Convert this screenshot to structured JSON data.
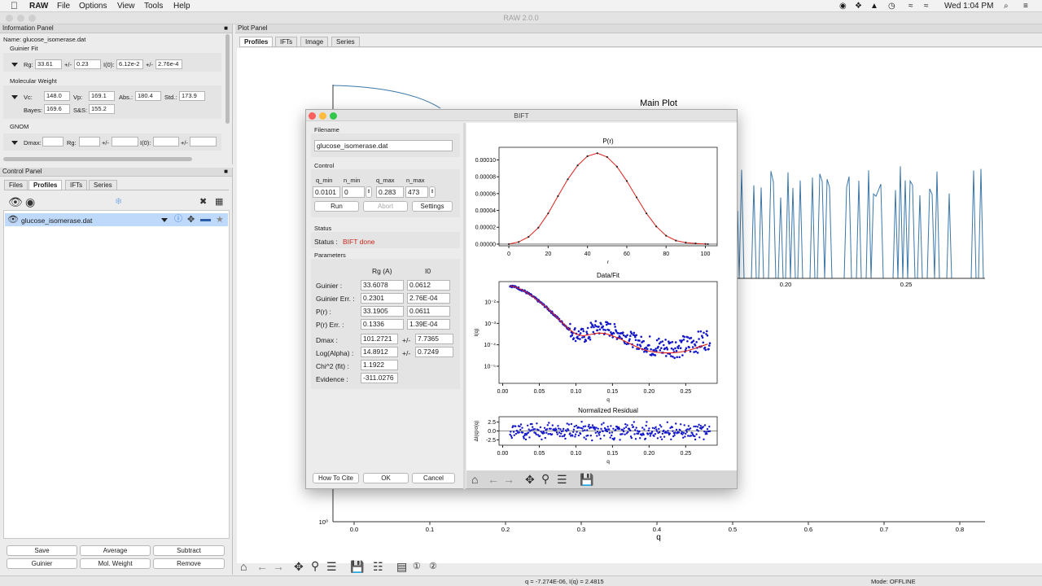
{
  "menubar": {
    "app": "RAW",
    "items": [
      "File",
      "Options",
      "View",
      "Tools",
      "Help"
    ],
    "clock": "Wed 1:04 PM"
  },
  "window": {
    "title": "RAW 2.0.0"
  },
  "info_panel": {
    "title": "Information Panel",
    "name": "Name:  glucose_isomerase.dat",
    "guinier": {
      "title": "Guinier Fit",
      "rg_label": "Rg:",
      "rg": "33.61",
      "pm": "+/-",
      "rg_err": "0.23",
      "i0_label": "I(0):",
      "i0": "6.12e-2",
      "i0_err": "2.76e-4"
    },
    "mw": {
      "title": "Molecular Weight",
      "vc_label": "Vc:",
      "vc": "148.0",
      "vp_label": "Vp:",
      "vp": "169.1",
      "abs_label": "Abs.:",
      "abs": "180.4",
      "std_label": "Std.:",
      "std": "173.9",
      "bayes_label": "Bayes:",
      "bayes": "169.6",
      "ss_label": "S&S:",
      "ss": "155.2"
    },
    "gnom": {
      "title": "GNOM",
      "dmax_label": "Dmax:",
      "rg_label": "Rg:",
      "pm": "+/-",
      "i0_label": "I(0):"
    }
  },
  "control_panel": {
    "title": "Control Panel",
    "tabs": [
      "Files",
      "Profiles",
      "IFTs",
      "Series"
    ],
    "item": "glucose_isomerase.dat",
    "buttons": [
      "Save",
      "Average",
      "Subtract",
      "Guinier",
      "Mol. Weight",
      "Remove"
    ]
  },
  "plot_panel": {
    "title": "Plot Panel",
    "tabs": [
      "Profiles",
      "IFTs",
      "Image",
      "Series"
    ],
    "main_title": "Main Plot",
    "x_label": "q",
    "x_ticks": [
      "0.0",
      "0.1",
      "0.2",
      "0.3",
      "0.4",
      "0.5",
      "0.6",
      "0.7",
      "0.8"
    ],
    "y_tick": "10⁰",
    "top_ticks": [
      "0.20",
      "0.25"
    ]
  },
  "bift": {
    "title": "BIFT",
    "filename_label": "Filename",
    "filename": "glucose_isomerase.dat",
    "control_label": "Control",
    "qmin_label": "q_min",
    "nmin_label": "n_min",
    "qmax_label": "q_max",
    "nmax_label": "n_max",
    "qmin": "0.0101",
    "nmin": "0",
    "qmax": "0.283",
    "nmax": "473",
    "run": "Run",
    "abort": "Abort",
    "settings": "Settings",
    "status_label": "Status",
    "status_prefix": "Status :",
    "status_value": "BIFT done",
    "params_label": "Parameters",
    "col_rg": "Rg (A)",
    "col_i0": "I0",
    "rows": [
      {
        "label": "Guinier :",
        "v1": "33.6078",
        "v2": "0.0612"
      },
      {
        "label": "Guinier Err. :",
        "v1": "0.2301",
        "v2": "2.76E-04"
      },
      {
        "label": "P(r) :",
        "v1": "33.1905",
        "v2": "0.0611"
      },
      {
        "label": "P(r) Err. :",
        "v1": "0.1336",
        "v2": "1.39E-04"
      }
    ],
    "dmax_label": "Dmax :",
    "dmax": "101.2721",
    "dmax_err": "7.7365",
    "alpha_label": "Log(Alpha) :",
    "alpha": "14.8912",
    "alpha_err": "0.7249",
    "pm": "+/-",
    "chi_label": "Chi^2 (fit) :",
    "chi": "1.1922",
    "evidence_label": "Evidence :",
    "evidence": "-311.0276",
    "how_to_cite": "How To Cite",
    "ok": "OK",
    "cancel": "Cancel"
  },
  "statusbar": {
    "coords": "q = -7.274E-06, I(q) = 2.4815",
    "mode": "Mode: OFFLINE"
  },
  "chart_data": [
    {
      "type": "line",
      "title": "P(r)",
      "xlabel": "r",
      "ylabel": "",
      "x_ticks": [
        "0",
        "20",
        "40",
        "60",
        "80",
        "100"
      ],
      "y_ticks": [
        "0.00000",
        "0.00002",
        "0.00004",
        "0.00006",
        "0.00008",
        "0.00010"
      ],
      "xlim": [
        -5,
        106
      ],
      "ylim": [
        -2e-06,
        0.000115
      ],
      "series": [
        {
          "x": [
            0,
            5,
            10,
            15,
            20,
            25,
            30,
            35,
            40,
            45,
            50,
            55,
            60,
            65,
            70,
            75,
            80,
            85,
            90,
            95,
            100,
            101.27
          ],
          "y": [
            0,
            2.5e-06,
            8.5e-06,
            1.95e-05,
            3.65e-05,
            5.7e-05,
            7.7e-05,
            9.35e-05,
            0.0001045,
            0.000108,
            0.0001035,
            9.2e-05,
            7.5e-05,
            5.55e-05,
            3.65e-05,
            2.1e-05,
            1e-05,
            4.2e-06,
            1.8e-06,
            8e-07,
            2e-07,
            0
          ]
        }
      ]
    },
    {
      "type": "scatter",
      "title": "Data/Fit",
      "xlabel": "q",
      "ylabel": "I(q)",
      "x_ticks": [
        "0.00",
        "0.05",
        "0.10",
        "0.15",
        "0.20",
        "0.25"
      ],
      "y_ticks": [
        "10⁻⁵",
        "10⁻⁴",
        "10⁻³",
        "10⁻²"
      ],
      "xlim": [
        -0.005,
        0.293
      ],
      "ylim_log10": [
        -5.8,
        -1.05
      ],
      "fit": {
        "x": [
          0.01,
          0.02,
          0.03,
          0.04,
          0.05,
          0.06,
          0.07,
          0.08,
          0.09,
          0.1,
          0.11,
          0.12,
          0.13,
          0.14,
          0.15,
          0.16,
          0.17,
          0.18,
          0.19,
          0.2,
          0.21,
          0.22,
          0.23,
          0.24,
          0.25,
          0.26,
          0.27,
          0.28
        ],
        "log10_y": [
          -1.24,
          -1.33,
          -1.5,
          -1.72,
          -1.98,
          -2.26,
          -2.58,
          -2.92,
          -3.25,
          -3.5,
          -3.58,
          -3.52,
          -3.45,
          -3.47,
          -3.58,
          -3.72,
          -3.88,
          -4.05,
          -4.2,
          -4.3,
          -4.35,
          -4.38,
          -4.38,
          -4.35,
          -4.3,
          -4.2,
          -4.08,
          -3.97
        ]
      }
    },
    {
      "type": "scatter",
      "title": "Normalized Residual",
      "xlabel": "q",
      "ylabel": "ΔI(q)/σ(q)",
      "x_ticks": [
        "0.00",
        "0.05",
        "0.10",
        "0.15",
        "0.20",
        "0.25"
      ],
      "y_ticks": [
        "2.5",
        "0.0",
        "-2.5"
      ],
      "xlim": [
        -0.005,
        0.293
      ],
      "ylim": [
        -4,
        4
      ]
    },
    {
      "type": "line",
      "title": "Main Plot",
      "xlabel": "q",
      "x_ticks": [
        "0.0",
        "0.1",
        "0.2",
        "0.3",
        "0.4",
        "0.5",
        "0.6",
        "0.7",
        "0.8"
      ]
    }
  ]
}
